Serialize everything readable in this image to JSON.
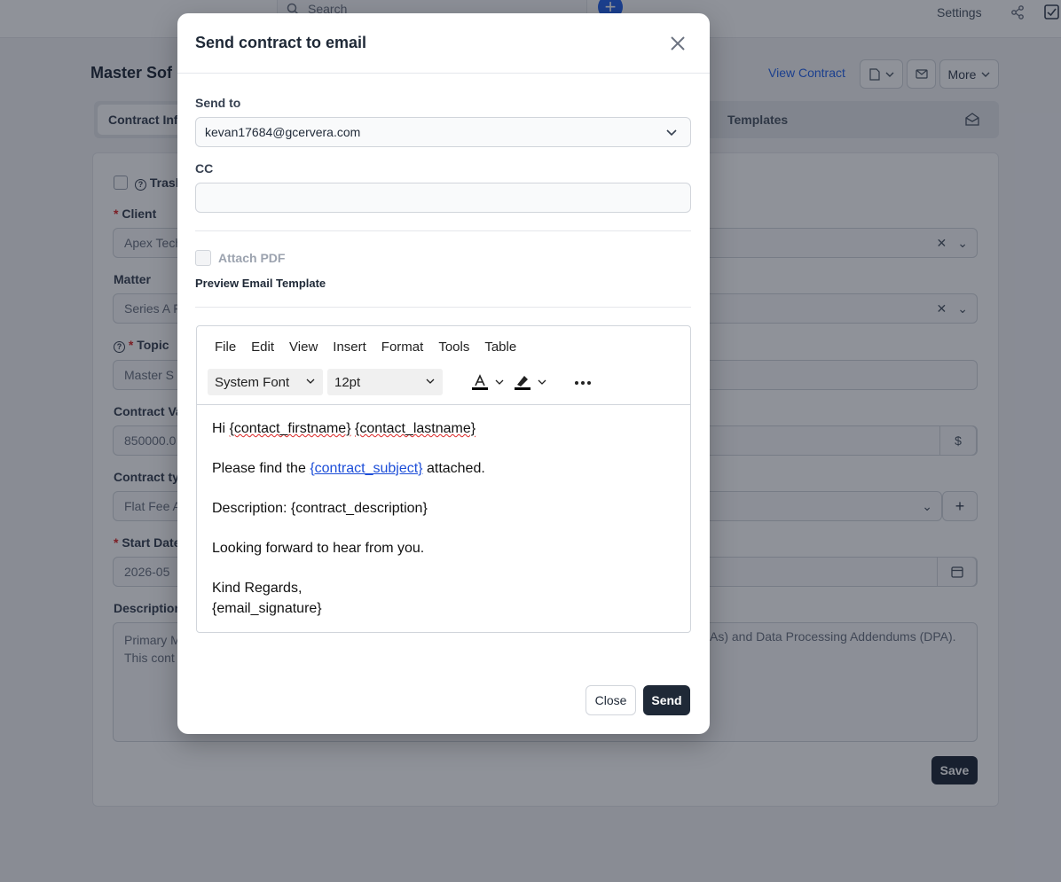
{
  "topbar": {
    "search_placeholder": "Search",
    "add_icon": "plus-icon",
    "settings_label": "Settings",
    "share_icon": "share-icon",
    "tasks_icon": "checkbox-icon"
  },
  "page": {
    "title": "Master Sof",
    "view_contract_label": "View Contract",
    "more_label": "More",
    "save_label": "Save"
  },
  "tabs": {
    "active": "Contract Info",
    "templates": "Templates"
  },
  "form": {
    "trash_label": "Trash",
    "client_label": "Client",
    "client_value": "Apex Tech",
    "matter_label": "Matter",
    "matter_value": "Series A F",
    "topic_label": "Topic",
    "topic_value": "Master S",
    "contract_value_label": "Contract Va",
    "contract_value": "850000.0",
    "currency_symbol": "$",
    "contract_type_label": "Contract ty",
    "contract_type_value": "Flat Fee A",
    "start_date_label": "Start Date",
    "start_date_value": "2026-05",
    "description_label": "Description",
    "description_line1": "Primary M",
    "description_line2": "This cont",
    "description_right": "As) and Data Processing Addendums (DPA)."
  },
  "modal": {
    "title": "Send contract to email",
    "send_to_label": "Send to",
    "send_to_value": "kevan17684@gcervera.com",
    "cc_label": "CC",
    "cc_value": "",
    "attach_pdf_label": "Attach PDF",
    "attach_pdf_checked": false,
    "preview_label": "Preview Email Template",
    "editor": {
      "menu": [
        "File",
        "Edit",
        "View",
        "Insert",
        "Format",
        "Tools",
        "Table"
      ],
      "font_family": "System Font",
      "font_size": "12pt",
      "text_color_icon": "text-color-icon",
      "highlight_icon": "highlight-icon",
      "more_icon": "more-horizontal-icon",
      "body": {
        "greeting_hi": "Hi",
        "contact_firstname": "{contact_firstname}",
        "contact_lastname": "{contact_lastname}",
        "find_prefix": "Please find the",
        "contract_subject": "{contract_subject}",
        "find_suffix": "attached.",
        "description_line": "Description: {contract_description}",
        "looking_forward": "Looking forward to hear from you.",
        "kind_regards": "Kind Regards,",
        "email_signature": "{email_signature}"
      }
    },
    "close_label": "Close",
    "send_label": "Send"
  },
  "colors": {
    "primary_dark": "#1f2937",
    "link_blue": "#2563eb",
    "required_red": "#dc2626",
    "overlay": "rgba(17,24,39,0.47)"
  }
}
